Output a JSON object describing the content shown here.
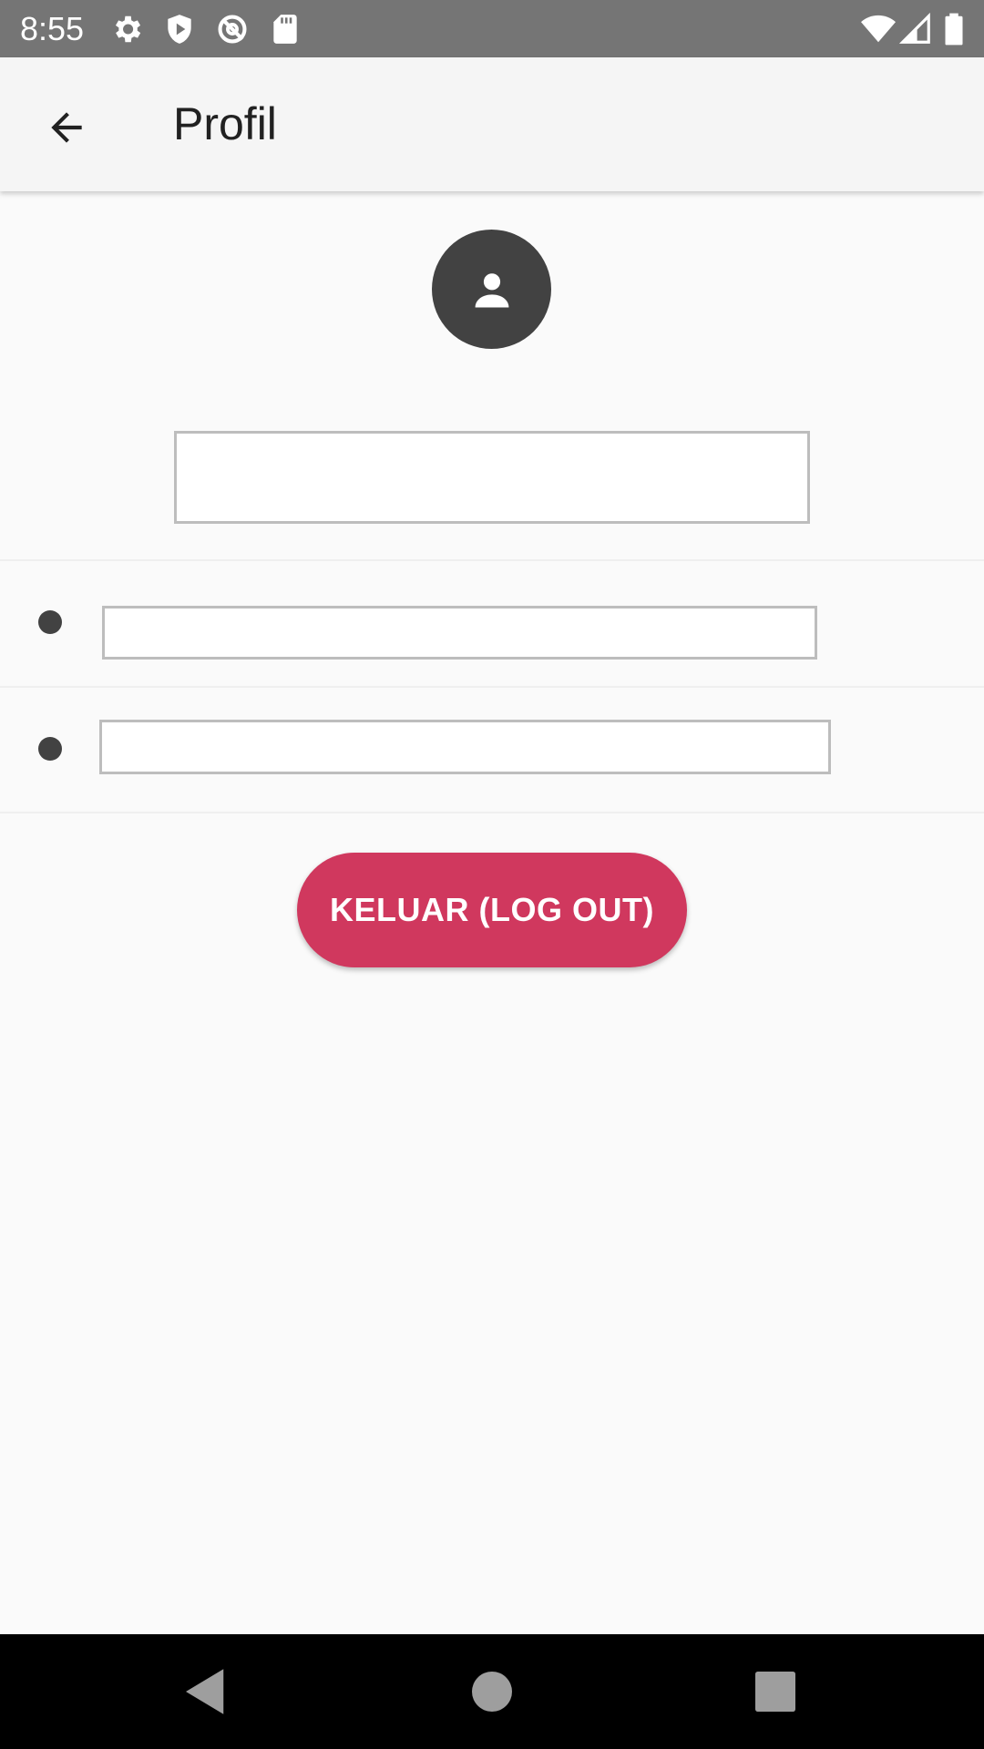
{
  "status_bar": {
    "time": "8:55",
    "left_icons": [
      "gear-icon",
      "shield-play-icon",
      "no-sync-icon",
      "sd-card-icon"
    ],
    "right_icons": [
      "wifi-icon",
      "signal-icon",
      "battery-icon"
    ]
  },
  "app_bar": {
    "title": "Profil",
    "back_icon": "arrow-back-icon"
  },
  "profile": {
    "avatar_icon": "person-icon",
    "name_value": "",
    "fields": [
      {
        "value": ""
      },
      {
        "value": ""
      }
    ]
  },
  "actions": {
    "logout_label": "KELUAR (LOG OUT)"
  },
  "colors": {
    "status_bar": "#757575",
    "app_bar": "#f5f5f5",
    "accent": "#d0385e",
    "avatar": "#424242"
  },
  "nav_bar": {
    "icons": [
      "back-triangle-icon",
      "home-circle-icon",
      "recents-square-icon"
    ]
  }
}
